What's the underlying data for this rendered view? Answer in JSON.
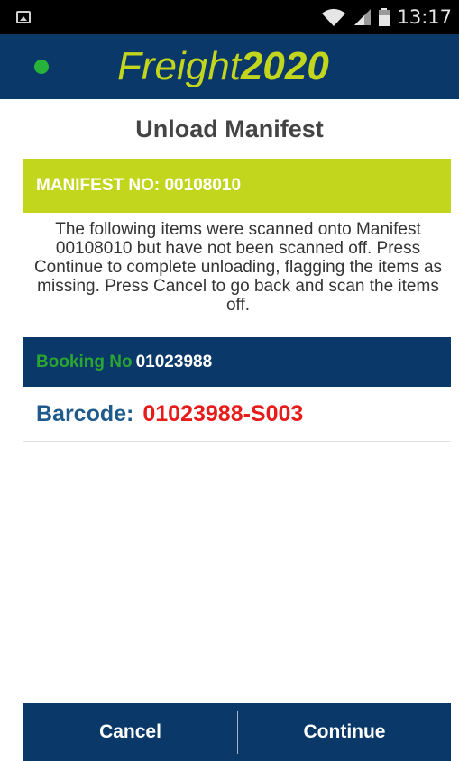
{
  "status_bar": {
    "time": "13:17",
    "icons": [
      "image-notification-icon",
      "wifi-icon",
      "signal-icon",
      "battery-icon"
    ]
  },
  "brand": {
    "name_part1": "Freight",
    "name_part2": "2020",
    "status_dot_color": "#27b23a",
    "accent_color": "#c3d61e",
    "bar_color": "#0a3868"
  },
  "page": {
    "title": "Unload Manifest"
  },
  "manifest": {
    "label": "MANIFEST NO: 00108010"
  },
  "info": {
    "text": "The following items were scanned onto Manifest 00108010 but have not been scanned off. Press Continue to complete unloading, flagging the items as missing. Press Cancel to go back and scan the items off."
  },
  "booking": {
    "label": "Booking No",
    "number": "01023988"
  },
  "barcode": {
    "label": "Barcode:",
    "value": "01023988-S003",
    "value_color": "#e81b1b"
  },
  "actions": {
    "cancel_label": "Cancel",
    "continue_label": "Continue"
  }
}
